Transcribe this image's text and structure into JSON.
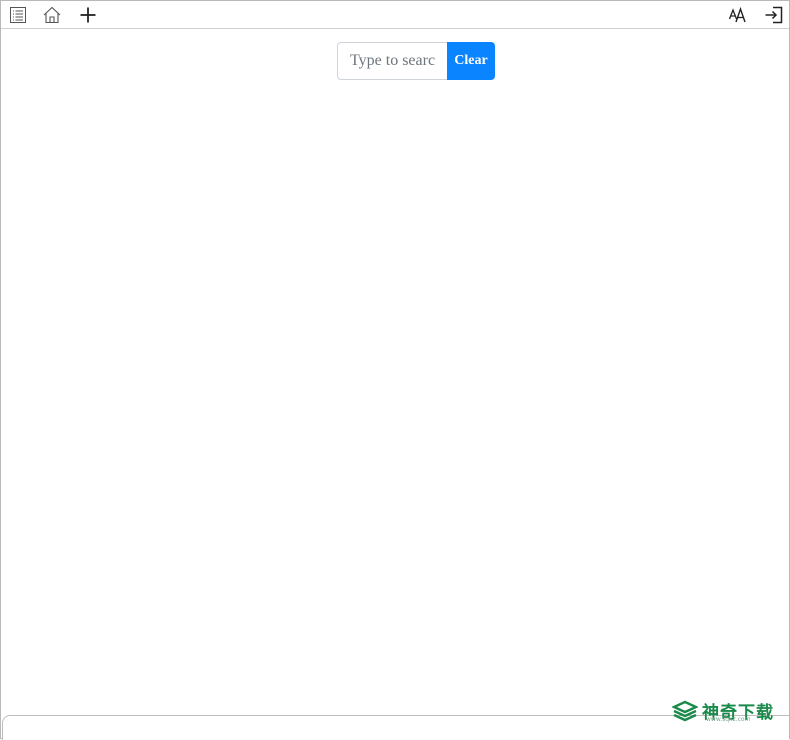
{
  "toolbar": {
    "left_icons": [
      "toc-icon",
      "home-icon",
      "plus-icon"
    ],
    "right_icons": [
      "font-size-icon",
      "exit-icon"
    ]
  },
  "search": {
    "placeholder": "Type to search",
    "clear_label": "Clear"
  },
  "colors": {
    "accent": "#0a84ff",
    "watermark": "#1a8a4a"
  },
  "watermark": {
    "text": "神奇下载",
    "sub": "www.sqxz.com"
  }
}
